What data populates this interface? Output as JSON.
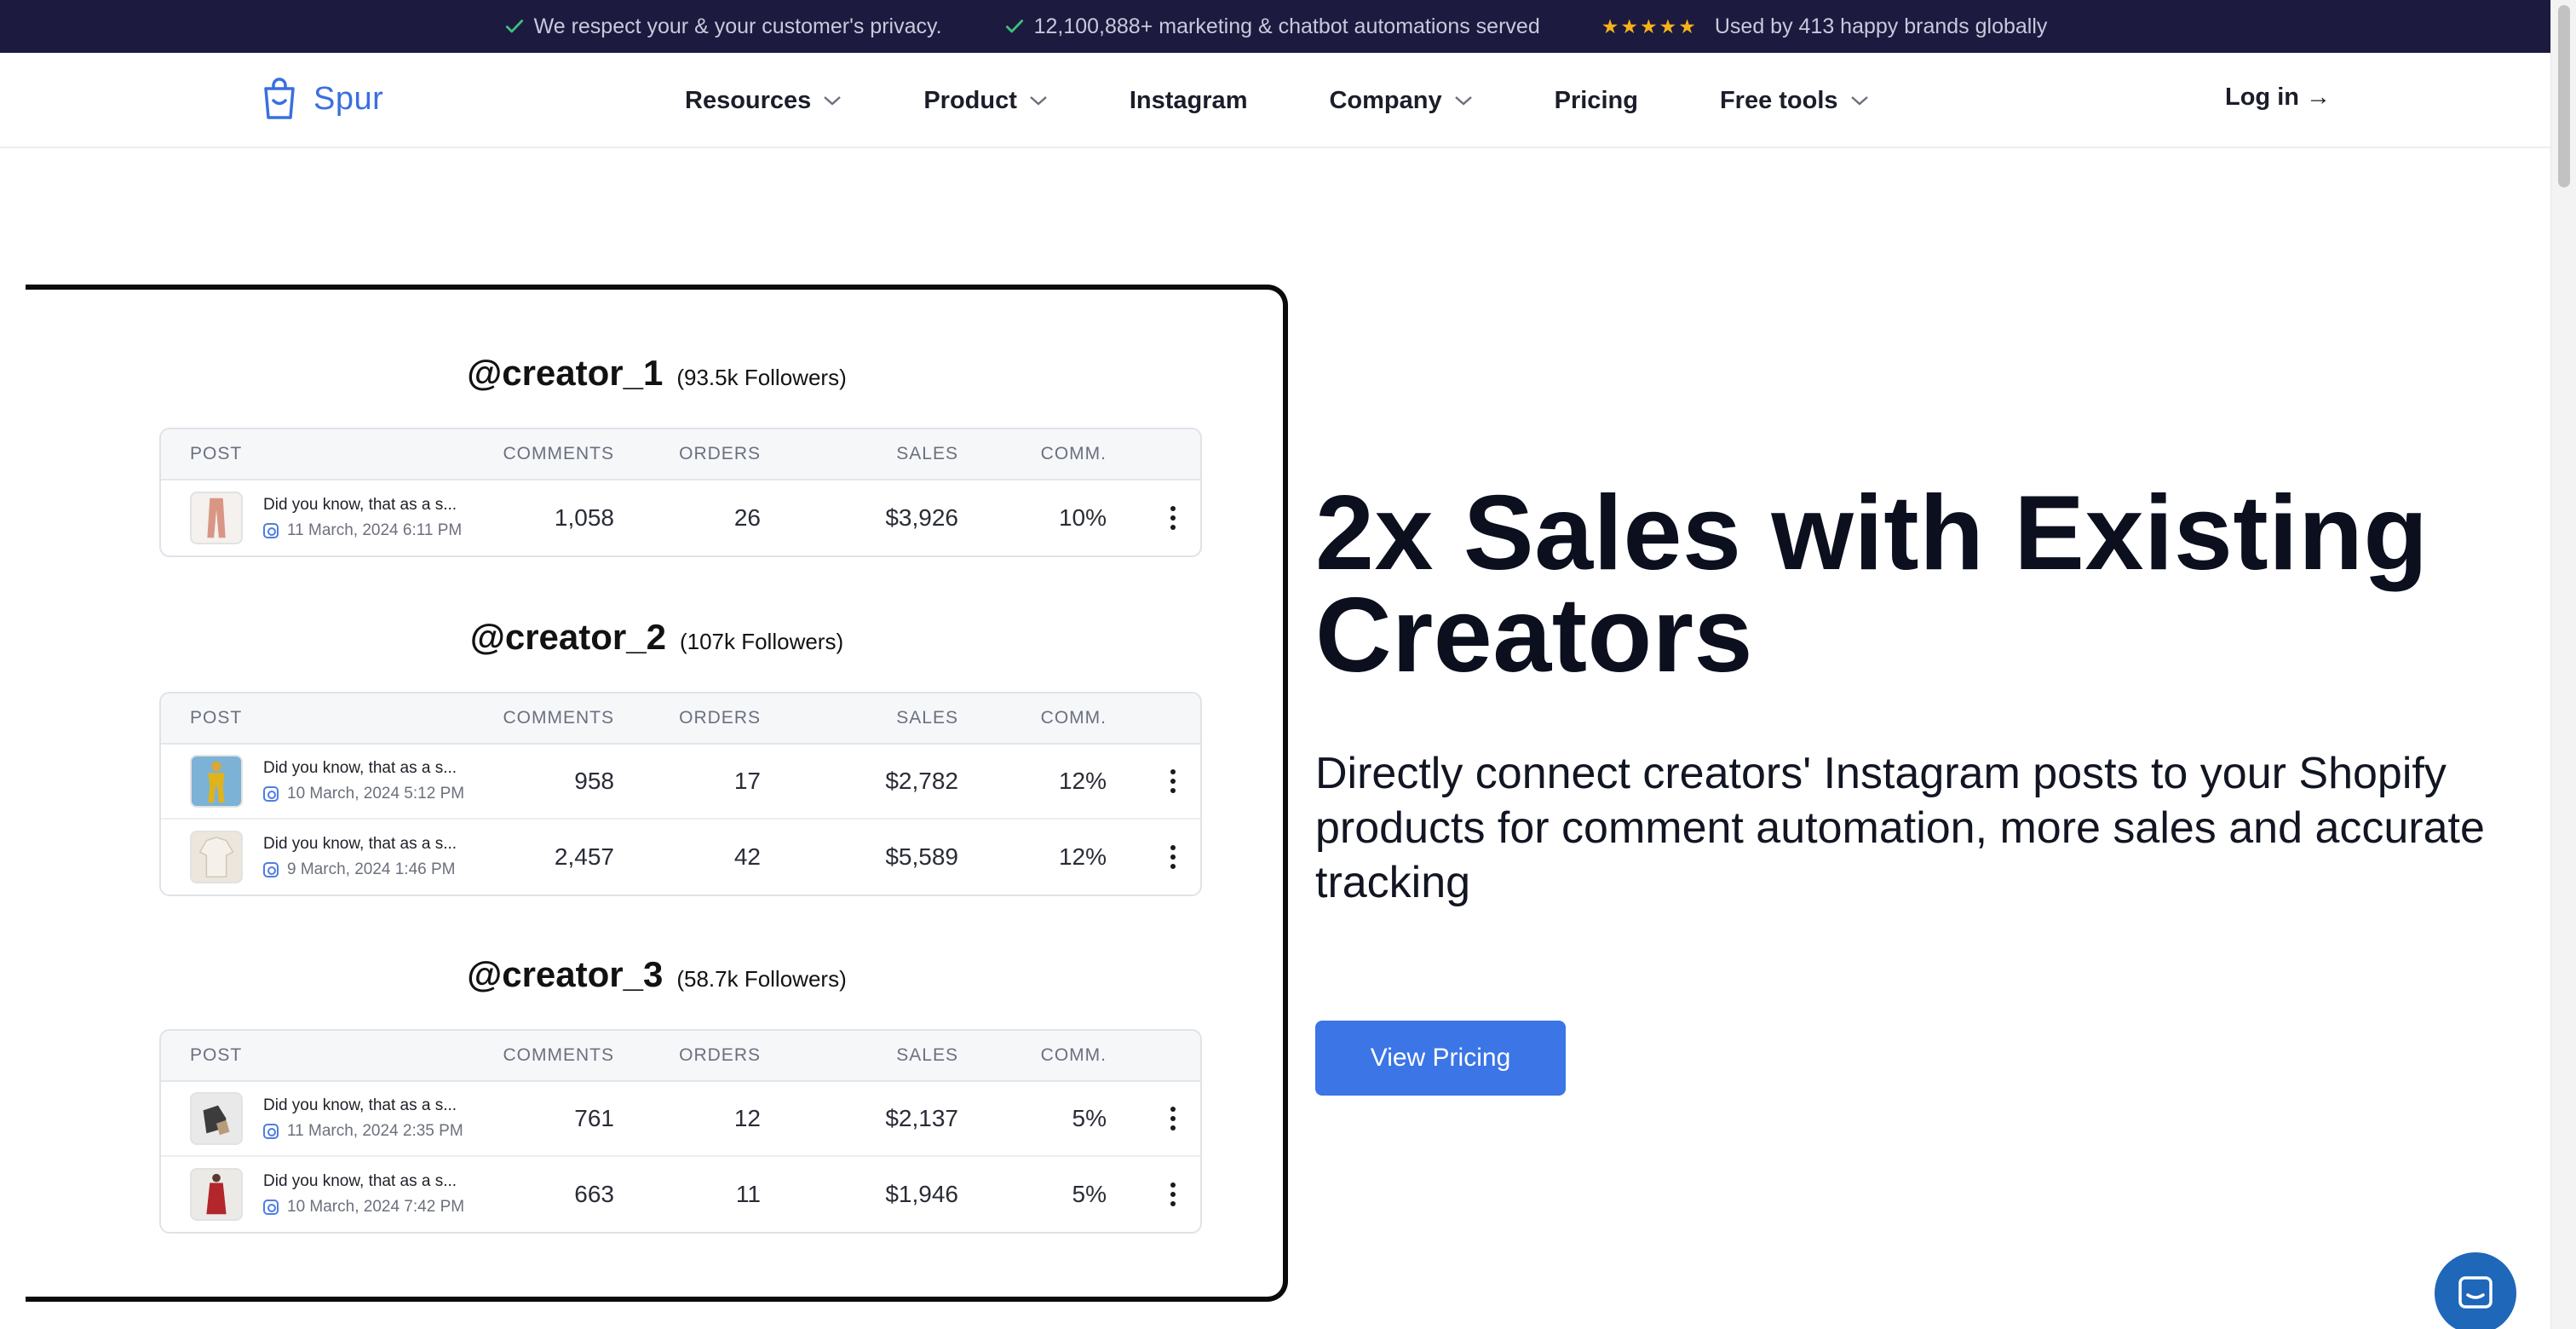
{
  "banner": {
    "items": [
      {
        "icon": "check-icon",
        "text": "We respect your & your customer's privacy."
      },
      {
        "icon": "check-icon",
        "text": "12,100,888+ marketing & chatbot automations served"
      },
      {
        "icon": "stars-icon",
        "text": "Used by 413 happy brands globally"
      }
    ],
    "accent": "#f7b21a"
  },
  "nav": {
    "brand": "Spur",
    "links": [
      {
        "label": "Resources",
        "has_menu": true
      },
      {
        "label": "Product",
        "has_menu": true
      },
      {
        "label": "Instagram",
        "has_menu": false
      },
      {
        "label": "Company",
        "has_menu": true
      },
      {
        "label": "Pricing",
        "has_menu": false
      },
      {
        "label": "Free tools",
        "has_menu": true
      }
    ],
    "login": "Log in →"
  },
  "table_headers": {
    "post": "POST",
    "comments": "COMMENTS",
    "orders": "ORDERS",
    "sales": "SALES",
    "comm": "COMM."
  },
  "creators": [
    {
      "handle": "@creator_1",
      "followers": "(93.5k Followers)",
      "rows": [
        {
          "thumb": "pants",
          "caption": "Did you know, that as a s...",
          "date": "11 March, 2024 6:11 PM",
          "comments": "1,058",
          "orders": "26",
          "sales": "$3,926",
          "comm": "10%"
        }
      ]
    },
    {
      "handle": "@creator_2",
      "followers": "(107k Followers)",
      "rows": [
        {
          "thumb": "yellow-outfit",
          "caption": "Did you know, that as a s...",
          "date": "10 March, 2024 5:12 PM",
          "comments": "958",
          "orders": "17",
          "sales": "$2,782",
          "comm": "12%"
        },
        {
          "thumb": "shirt",
          "caption": "Did you know, that as a s...",
          "date": "9 March, 2024 1:46 PM",
          "comments": "2,457",
          "orders": "42",
          "sales": "$5,589",
          "comm": "12%"
        }
      ]
    },
    {
      "handle": "@creator_3",
      "followers": "(58.7k Followers)",
      "rows": [
        {
          "thumb": "shoe",
          "caption": "Did you know, that as a s...",
          "date": "11 March, 2024 2:35 PM",
          "comments": "761",
          "orders": "12",
          "sales": "$2,137",
          "comm": "5%"
        },
        {
          "thumb": "red-dress",
          "caption": "Did you know, that as a s...",
          "date": "10 March, 2024 7:42 PM",
          "comments": "663",
          "orders": "11",
          "sales": "$1,946",
          "comm": "5%"
        }
      ]
    }
  ],
  "hero": {
    "title": "2x Sales with Existing Creators",
    "subtitle": "Directly connect creators' Instagram posts to your Shopify products for comment automation, more sales and accurate tracking",
    "cta": "View Pricing",
    "cta_color": "#3b75e6"
  },
  "chat_widget": {
    "icon": "chat-icon"
  }
}
